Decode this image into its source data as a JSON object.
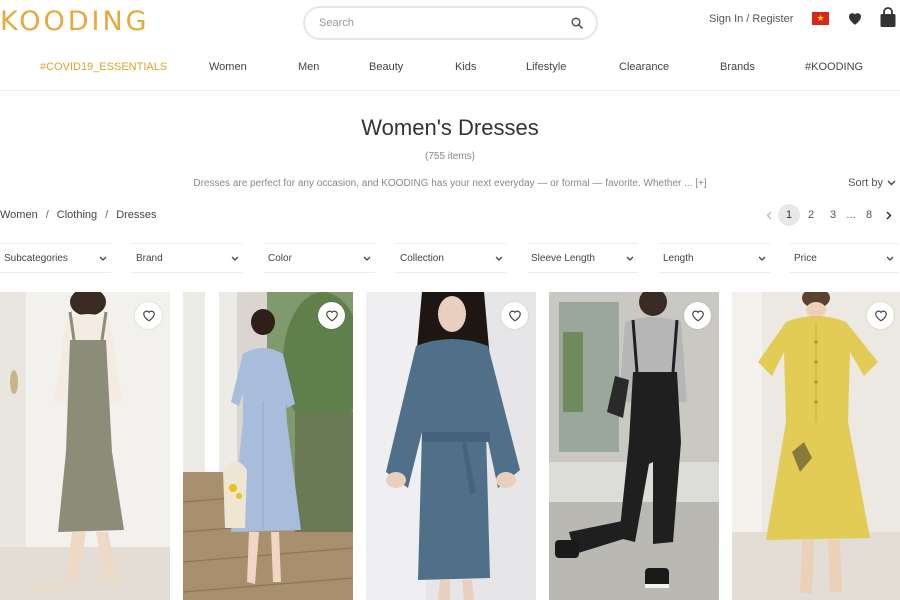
{
  "header": {
    "logo": "KOODING",
    "search_placeholder": "Search",
    "signin": "Sign In / Register"
  },
  "nav": {
    "items": [
      "#COVID19_ESSENTIALS",
      "Women",
      "Men",
      "Beauty",
      "Kids",
      "Lifestyle",
      "Clearance",
      "Brands",
      "#KOODING"
    ]
  },
  "page": {
    "title": "Women's Dresses",
    "count": "(755 items)",
    "description": "Dresses are perfect for any occasion, and KOODING has your next everyday — or formal — favorite. Whether ... [+]",
    "sort_label": "Sort by"
  },
  "breadcrumb": [
    "Women",
    "Clothing",
    "Dresses"
  ],
  "pagination": {
    "pages": [
      "1",
      "2",
      "3"
    ],
    "ellipsis": "...",
    "last": "8",
    "current": "1"
  },
  "filters": [
    "Subcategories",
    "Brand",
    "Color",
    "Collection",
    "Sleeve Length",
    "Length",
    "Price"
  ],
  "products": [
    {
      "name": "olive-overall-dress",
      "bg": "#f3f1ee",
      "dress": "#8b8d79",
      "shirt": "#f4ece2"
    },
    {
      "name": "blue-wrap-dress",
      "bg": "#d9d6cf",
      "dress": "#a8bcdc",
      "shirt": "#a8bcdc"
    },
    {
      "name": "blue-sweatshirt-dress",
      "bg": "#e6e6e8",
      "dress": "#50708a",
      "shirt": "#50708a"
    },
    {
      "name": "black-overalls",
      "bg": "#dcdcd8",
      "dress": "#1f1f1f",
      "shirt": "#b6b6b6"
    },
    {
      "name": "yellow-linen-dress",
      "bg": "#ece8e2",
      "dress": "#e3cc55",
      "shirt": "#e3cc55"
    }
  ],
  "colors": {
    "accent": "#e8a93c",
    "flag_red": "#d8261c",
    "flag_star": "#ffda1a"
  }
}
